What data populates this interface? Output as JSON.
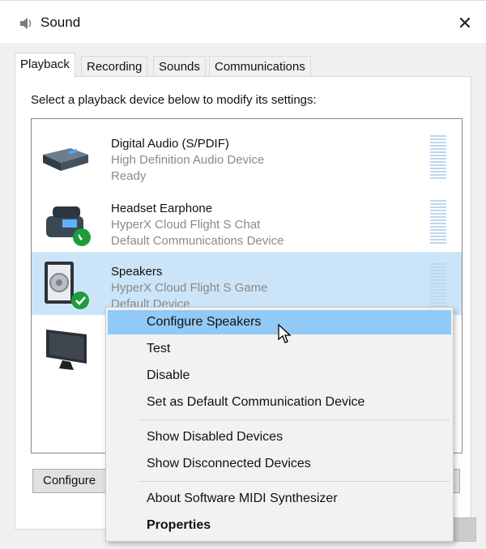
{
  "window": {
    "title": "Sound",
    "close_label": "✕"
  },
  "tabs": [
    {
      "label": "Playback"
    },
    {
      "label": "Recording"
    },
    {
      "label": "Sounds"
    },
    {
      "label": "Communications"
    }
  ],
  "instruction": "Select a playback device below to modify its settings:",
  "devices": [
    {
      "name": "Digital Audio (S/PDIF)",
      "description": "High Definition Audio Device",
      "status": "Ready",
      "icon": "digital-audio-icon"
    },
    {
      "name": "Headset Earphone",
      "description": "HyperX Cloud Flight S Chat",
      "status": "Default Communications Device",
      "icon": "headset-phone-icon"
    },
    {
      "name": "Speakers",
      "description": "HyperX Cloud Flight S Game",
      "status": "Default Device",
      "icon": "speaker-icon"
    },
    {
      "name": "",
      "description": "",
      "status": "",
      "icon": "monitor-icon"
    }
  ],
  "buttons": {
    "configure": "Configure"
  },
  "context_menu": {
    "items": [
      {
        "label": "Configure Speakers"
      },
      {
        "label": "Test"
      },
      {
        "label": "Disable"
      },
      {
        "label": "Set as Default Communication Device"
      },
      {
        "label": "Show Disabled Devices"
      },
      {
        "label": "Show Disconnected Devices"
      },
      {
        "label": "About Software MIDI Synthesizer"
      },
      {
        "label": "Properties"
      }
    ]
  },
  "colors": {
    "selection": "#cce4f7",
    "menu_highlight": "#91c9f7",
    "check_green": "#1f9d3a"
  }
}
